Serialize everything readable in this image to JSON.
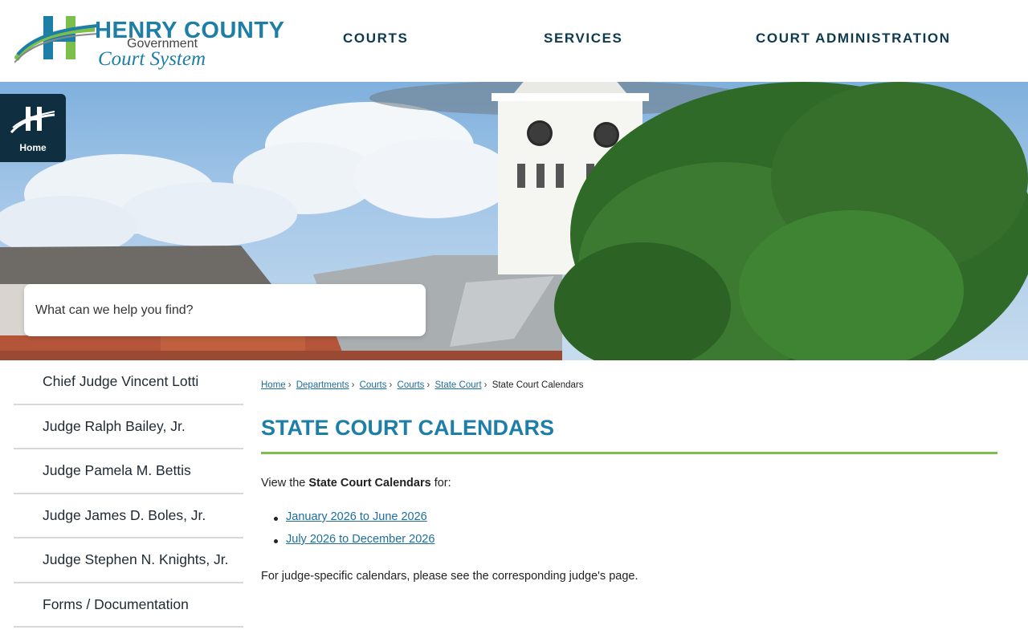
{
  "header": {
    "logo": {
      "title": "HENRY COUNTY",
      "subtitle": "Government",
      "script": "Court System"
    },
    "nav": [
      "COURTS",
      "SERVICES",
      "COURT ADMINISTRATION"
    ]
  },
  "home_tile": {
    "label": "Home",
    "icon": "henry-h-logo-icon"
  },
  "search": {
    "placeholder": "What can we help you find?"
  },
  "sidebar": {
    "items": [
      "Chief Judge Vincent Lotti",
      "Judge Ralph Bailey, Jr.",
      "Judge Pamela M. Bettis",
      "Judge James D. Boles, Jr.",
      "Judge Stephen N. Knights, Jr.",
      "Forms / Documentation"
    ]
  },
  "breadcrumb": {
    "links": [
      "Home",
      "Departments",
      "Courts",
      "Courts",
      "State Court"
    ],
    "current": "State Court Calendars"
  },
  "main": {
    "title": "STATE COURT CALENDARS",
    "intro_prefix": "View the ",
    "intro_bold": "State Court Calendars",
    "intro_suffix": " for:",
    "calendar_links": [
      "January 2026 to June 2026",
      "July 2026 to December 2026"
    ],
    "note": "For judge-specific calendars, please see the corresponding judge's page."
  },
  "colors": {
    "accent_blue": "#1d7ea8",
    "accent_green": "#7cbf4a",
    "nav_dark": "#0e3a4d",
    "home_tile": "#0f2f40",
    "link": "#1d6ea0"
  }
}
